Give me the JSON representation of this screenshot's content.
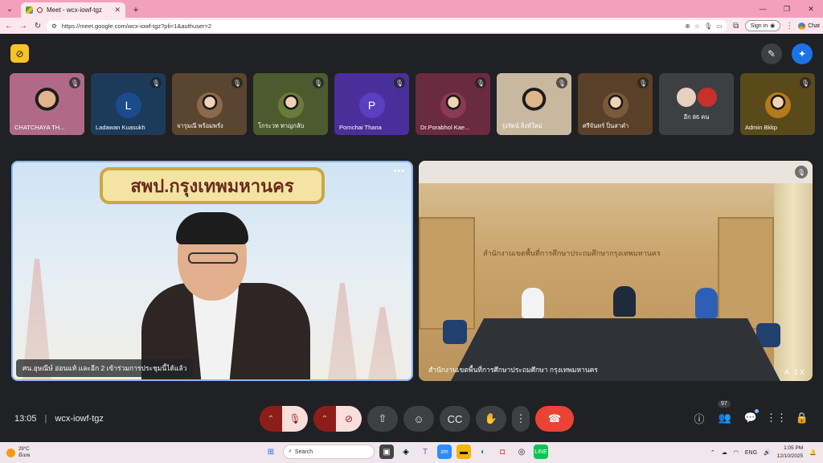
{
  "browser": {
    "tab_title": "Meet - wcx-iowf-tgz",
    "url": "https://meet.google.com/wcx-iowf-tgz?pli=1&authuser=2",
    "signin_label": "Sign in",
    "chat_label": "Chat"
  },
  "participants": [
    {
      "name": "CHATCHAYA TH...",
      "kind": "photo",
      "color": "#b06a88"
    },
    {
      "name": "Ladawan Kuasukh",
      "kind": "initial",
      "initial": "L",
      "color": "#1a4b8c",
      "tile": "#1c3a5a"
    },
    {
      "name": "จารุมณี พร้อมพรั่ง",
      "kind": "photo",
      "color": "#8a6a4a",
      "tile": "#5a4530"
    },
    {
      "name": "โกระวท ทาญกลับ",
      "kind": "photo",
      "color": "#6a7a3a",
      "tile": "#4d5a2e"
    },
    {
      "name": "Pornchai Thana",
      "kind": "initial",
      "initial": "P",
      "color": "#5a3fbf",
      "tile": "#4a2f9a"
    },
    {
      "name": "Dr.Porabhol Kae...",
      "kind": "photo",
      "color": "#8a3a55",
      "tile": "#6a2a40"
    },
    {
      "name": "รุ่งรัตน์ สิงห์ใหม่",
      "kind": "photo",
      "color": "#c8b8a0",
      "tile": "#9a8c7a"
    },
    {
      "name": "ศรีจันทร์ ปิ่นสาคำ",
      "kind": "photo",
      "color": "#7a5a3a",
      "tile": "#5a4028"
    },
    {
      "name": "อีก 86 คน",
      "kind": "group",
      "color": "#3c4043",
      "tile": "#3c4043"
    },
    {
      "name": "Admin Bkkp",
      "kind": "photo",
      "color": "#b57a1a",
      "tile": "#5a4a1a"
    }
  ],
  "main_left": {
    "banner": "สพป.กรุงเทพมหานคร",
    "caption": "ศน.อุษณีษ์ อ่อนแท้ และอีก 2 เข้าร่วมการประชุมนี้ได้แล้ว"
  },
  "main_right": {
    "wall_sign": "สำนักงานเขตพื้นที่การศึกษาประถมศึกษากรุงเทพมหานคร",
    "caption": "สำนักงานเขตพื้นที่การศึกษาประถมศึกษา กรุงเทพมหานคร",
    "zoom": "A 1X"
  },
  "footer": {
    "time": "13:05",
    "meeting_code": "wcx-iowf-tgz",
    "people_count": "97"
  },
  "taskbar": {
    "temperature": "29°C",
    "weather": "มีเมฆ",
    "search_placeholder": "Search",
    "lang": "ENG",
    "time": "1:05 PM",
    "date": "12/10/2025"
  }
}
